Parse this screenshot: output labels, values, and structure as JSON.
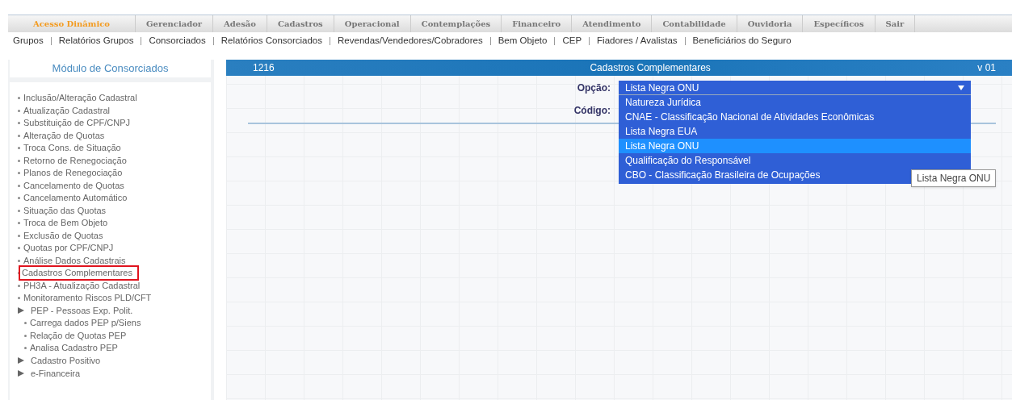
{
  "menu": [
    {
      "label": "Acesso Dinâmico",
      "selected": true
    },
    {
      "label": "Gerenciador",
      "selected": false
    },
    {
      "label": "Adesão",
      "selected": false
    },
    {
      "label": "Cadastros",
      "selected": false
    },
    {
      "label": "Operacional",
      "selected": false
    },
    {
      "label": "Contemplações",
      "selected": false
    },
    {
      "label": "Financeiro",
      "selected": false
    },
    {
      "label": "Atendimento",
      "selected": false
    },
    {
      "label": "Contabilidade",
      "selected": false
    },
    {
      "label": "Ouvidoria",
      "selected": false
    },
    {
      "label": "Específicos",
      "selected": false
    },
    {
      "label": "Sair",
      "selected": false
    }
  ],
  "submenu": [
    "Grupos",
    "Relatórios Grupos",
    "Consorciados",
    "Relatórios Consorciados",
    "Revendas/Vendedores/Cobradores",
    "Bem Objeto",
    "CEP",
    "Fiadores / Avalistas",
    "Beneficiários do Seguro"
  ],
  "sidebar": {
    "title": "Módulo de Consorciados",
    "items": [
      {
        "kind": "bullet",
        "label": "Inclusão/Alteração Cadastral",
        "highlighted": false
      },
      {
        "kind": "bullet",
        "label": "Atualização Cadastral",
        "highlighted": false
      },
      {
        "kind": "bullet",
        "label": "Substituição de CPF/CNPJ",
        "highlighted": false
      },
      {
        "kind": "bullet",
        "label": "Alteração de Quotas",
        "highlighted": false
      },
      {
        "kind": "bullet",
        "label": "Troca Cons. de Situação",
        "highlighted": false
      },
      {
        "kind": "bullet",
        "label": "Retorno de Renegociação",
        "highlighted": false
      },
      {
        "kind": "bullet",
        "label": "Planos de Renegociação",
        "highlighted": false
      },
      {
        "kind": "bullet",
        "label": "Cancelamento de Quotas",
        "highlighted": false
      },
      {
        "kind": "bullet",
        "label": "Cancelamento Automático",
        "highlighted": false
      },
      {
        "kind": "bullet",
        "label": "Situação das Quotas",
        "highlighted": false
      },
      {
        "kind": "bullet",
        "label": "Troca de Bem Objeto",
        "highlighted": false
      },
      {
        "kind": "bullet",
        "label": "Exclusão de Quotas",
        "highlighted": false
      },
      {
        "kind": "bullet",
        "label": "Quotas por CPF/CNPJ",
        "highlighted": false
      },
      {
        "kind": "bullet",
        "label": "Análise Dados Cadastrais",
        "highlighted": false
      },
      {
        "kind": "bullet",
        "label": "Cadastros Complementares",
        "highlighted": true
      },
      {
        "kind": "bullet",
        "label": "PH3A - Atualização Cadastral",
        "highlighted": false
      },
      {
        "kind": "bullet",
        "label": "Monitoramento Riscos PLD/CFT",
        "highlighted": false
      },
      {
        "kind": "group",
        "label": "PEP - Pessoas Exp. Polit.",
        "highlighted": false,
        "children": [
          {
            "kind": "bullet",
            "label": "Carrega dados PEP p/Siens",
            "highlighted": false
          },
          {
            "kind": "bullet",
            "label": "Relação de Quotas PEP",
            "highlighted": false
          },
          {
            "kind": "bullet",
            "label": "Analisa Cadastro PEP",
            "highlighted": false
          }
        ]
      },
      {
        "kind": "group",
        "label": "Cadastro Positivo",
        "highlighted": false
      },
      {
        "kind": "group",
        "label": "e-Financeira",
        "highlighted": false
      }
    ]
  },
  "panel": {
    "code": "1216",
    "title": "Cadastros Complementares",
    "version": "v 01",
    "option_label": "Opção:",
    "option_value": "Lista Negra ONU",
    "code_label": "Código:",
    "dropdown": [
      {
        "label": "Natureza Jurídica",
        "selected": false
      },
      {
        "label": "CNAE - Classificação Nacional de Atividades Econômicas",
        "selected": false
      },
      {
        "label": "Lista Negra EUA",
        "selected": false
      },
      {
        "label": "Lista Negra ONU",
        "selected": true
      },
      {
        "label": "Qualificação do Responsável",
        "selected": false
      },
      {
        "label": "CBO - Classificação Brasileira de Ocupações",
        "selected": false
      }
    ],
    "tooltip": "Lista Negra ONU"
  }
}
